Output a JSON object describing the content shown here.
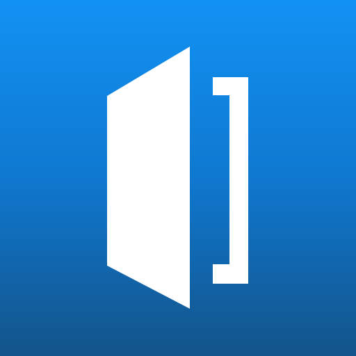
{
  "icon": {
    "name": "open-door-app-icon",
    "colors": {
      "gradient_top": "#1292f4",
      "gradient_mid": "#0f78cf",
      "gradient_bottom": "#13548a",
      "glyph": "#ffffff"
    }
  }
}
